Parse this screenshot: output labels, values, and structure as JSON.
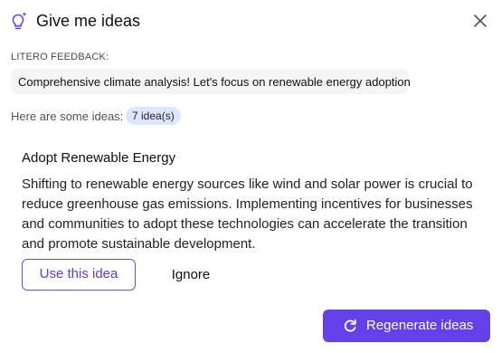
{
  "header": {
    "title": "Give me ideas",
    "icon": "lightbulb-sparkle-icon",
    "close_icon": "close-icon"
  },
  "feedback": {
    "label": "LITERO FEEDBACK:",
    "text": "Comprehensive climate analysis! Let's focus on renewable energy adoption"
  },
  "ideas": {
    "label": "Here are some ideas:",
    "count_badge": "7 idea(s)"
  },
  "idea": {
    "title": "Adopt Renewable Energy",
    "body": "Shifting to renewable energy sources like wind and solar power is crucial to reduce greenhouse gas emissions. Implementing incentives for businesses and communities to adopt these technologies can accelerate the transition and promote sustainable development."
  },
  "actions": {
    "use_label": "Use this idea",
    "ignore_label": "Ignore",
    "regenerate_label": "Regenerate ideas",
    "regenerate_icon": "refresh-icon"
  },
  "colors": {
    "accent": "#6340e8",
    "badge_bg": "#dde6ff",
    "feedback_bg": "#f5f5f7"
  }
}
